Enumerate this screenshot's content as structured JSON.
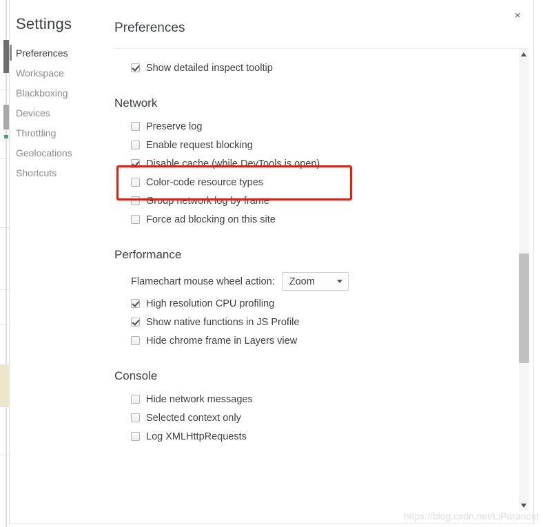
{
  "window": {
    "close_label": "×"
  },
  "sidebar": {
    "title": "Settings",
    "items": [
      {
        "label": "Preferences",
        "selected": true
      },
      {
        "label": "Workspace",
        "selected": false
      },
      {
        "label": "Blackboxing",
        "selected": false
      },
      {
        "label": "Devices",
        "selected": false
      },
      {
        "label": "Throttling",
        "selected": false
      },
      {
        "label": "Geolocations",
        "selected": false
      },
      {
        "label": "Shortcuts",
        "selected": false
      }
    ]
  },
  "content": {
    "title": "Preferences",
    "top_options": [
      {
        "label": "Show detailed inspect tooltip",
        "checked": true
      }
    ],
    "groups": [
      {
        "title": "Network",
        "options": [
          {
            "label": "Preserve log",
            "checked": false
          },
          {
            "label": "Enable request blocking",
            "checked": false
          },
          {
            "label": "Disable cache (while DevTools is open)",
            "checked": true,
            "highlighted": true
          },
          {
            "label": "Color-code resource types",
            "checked": false
          },
          {
            "label": "Group network log by frame",
            "checked": false
          },
          {
            "label": "Force ad blocking on this site",
            "checked": false
          }
        ]
      },
      {
        "title": "Performance",
        "select": {
          "label": "Flamechart mouse wheel action:",
          "value": "Zoom"
        },
        "options": [
          {
            "label": "High resolution CPU profiling",
            "checked": true
          },
          {
            "label": "Show native functions in JS Profile",
            "checked": true
          },
          {
            "label": "Hide chrome frame in Layers view",
            "checked": false
          }
        ]
      },
      {
        "title": "Console",
        "options": [
          {
            "label": "Hide network messages",
            "checked": false
          },
          {
            "label": "Selected context only",
            "checked": false
          },
          {
            "label": "Log XMLHttpRequests",
            "checked": false
          }
        ]
      }
    ]
  },
  "annotation": {
    "color": "#fa1600",
    "target": "Disable cache (while DevTools is open)"
  },
  "watermark": {
    "text": "https://blog.csdn.net/LiParanoid"
  }
}
